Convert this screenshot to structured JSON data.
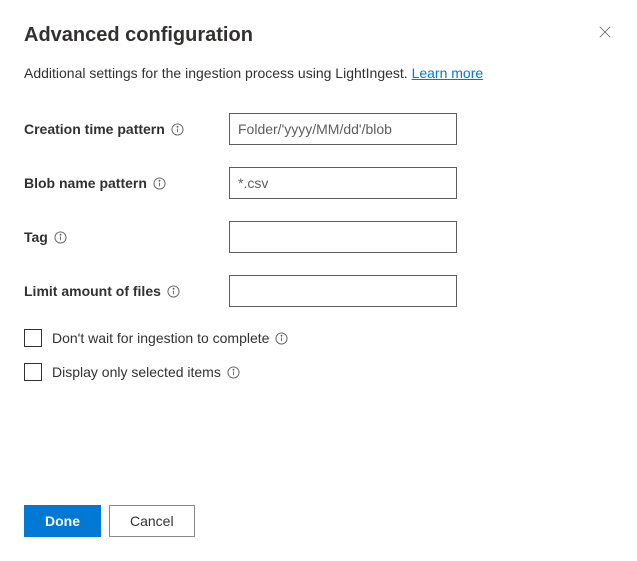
{
  "header": {
    "title": "Advanced configuration"
  },
  "subtitle": {
    "text": "Additional settings for the ingestion process using LightIngest. ",
    "link": "Learn more"
  },
  "fields": {
    "creationTime": {
      "label": "Creation time pattern",
      "placeholder": "Folder/'yyyy/MM/dd'/blob",
      "value": ""
    },
    "blobName": {
      "label": "Blob name pattern",
      "placeholder": "*.csv",
      "value": ""
    },
    "tag": {
      "label": "Tag",
      "placeholder": "",
      "value": ""
    },
    "limitFiles": {
      "label": "Limit amount of files",
      "placeholder": "",
      "value": ""
    }
  },
  "checkboxes": {
    "dontWait": {
      "label": "Don't wait for ingestion to complete"
    },
    "displaySelected": {
      "label": "Display only selected items"
    }
  },
  "footer": {
    "done": "Done",
    "cancel": "Cancel"
  }
}
